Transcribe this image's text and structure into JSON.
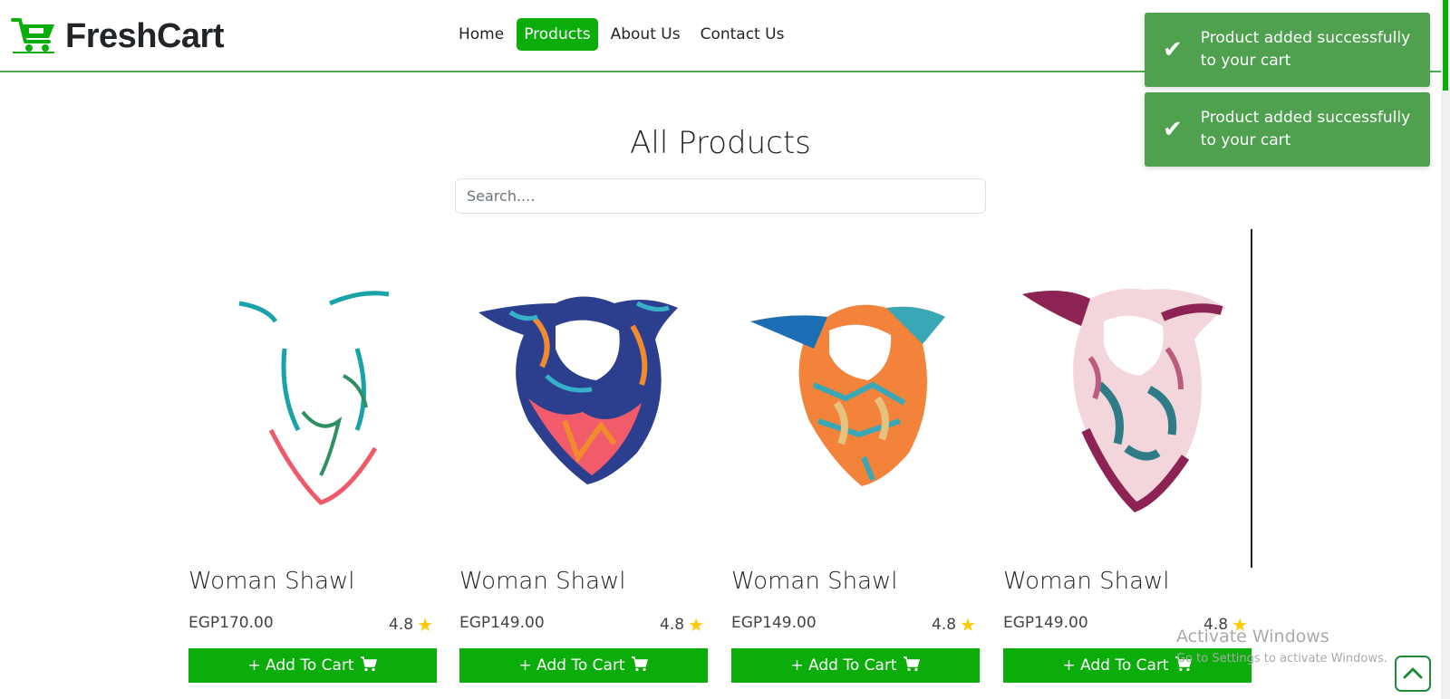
{
  "brand": {
    "name": "FreshCart",
    "icon": "cart-icon"
  },
  "nav": {
    "links": [
      {
        "label": "Home",
        "active": false
      },
      {
        "label": "Products",
        "active": true
      },
      {
        "label": "About Us",
        "active": false
      },
      {
        "label": "Contact Us",
        "active": false
      }
    ]
  },
  "page": {
    "title": "All Products",
    "search_placeholder": "Search...."
  },
  "products": [
    {
      "name": "Woman Shawl",
      "price": "EGP170.00",
      "rating": "4.8",
      "button": "+ Add To Cart",
      "colors": [
        "#ffffff",
        "#19a3a8",
        "#ef5a6a",
        "#2e8f63"
      ]
    },
    {
      "name": "Woman Shawl",
      "price": "EGP149.00",
      "rating": "4.8",
      "button": "+ Add To Cart",
      "colors": [
        "#2c3f8f",
        "#f25b6a",
        "#f08c2e",
        "#36b1c9"
      ]
    },
    {
      "name": "Woman Shawl",
      "price": "EGP149.00",
      "rating": "4.8",
      "button": "+ Add To Cart",
      "colors": [
        "#1d6fb5",
        "#f3833b",
        "#e6c27c",
        "#3aa7b6"
      ]
    },
    {
      "name": "Woman Shawl",
      "price": "EGP149.00",
      "rating": "4.8",
      "button": "+ Add To Cart",
      "colors": [
        "#8c2354",
        "#f2d6db",
        "#2f7c86",
        "#b95c7e"
      ]
    }
  ],
  "toasts": [
    {
      "message": "Product added successfully to your cart"
    },
    {
      "message": "Product added successfully to your cart"
    }
  ],
  "watermark": {
    "title": "Activate Windows",
    "subtitle": "Go to Settings to activate Windows."
  },
  "colors": {
    "accent": "#0aad0a",
    "toast": "#4fa150",
    "star": "#ffc908"
  }
}
